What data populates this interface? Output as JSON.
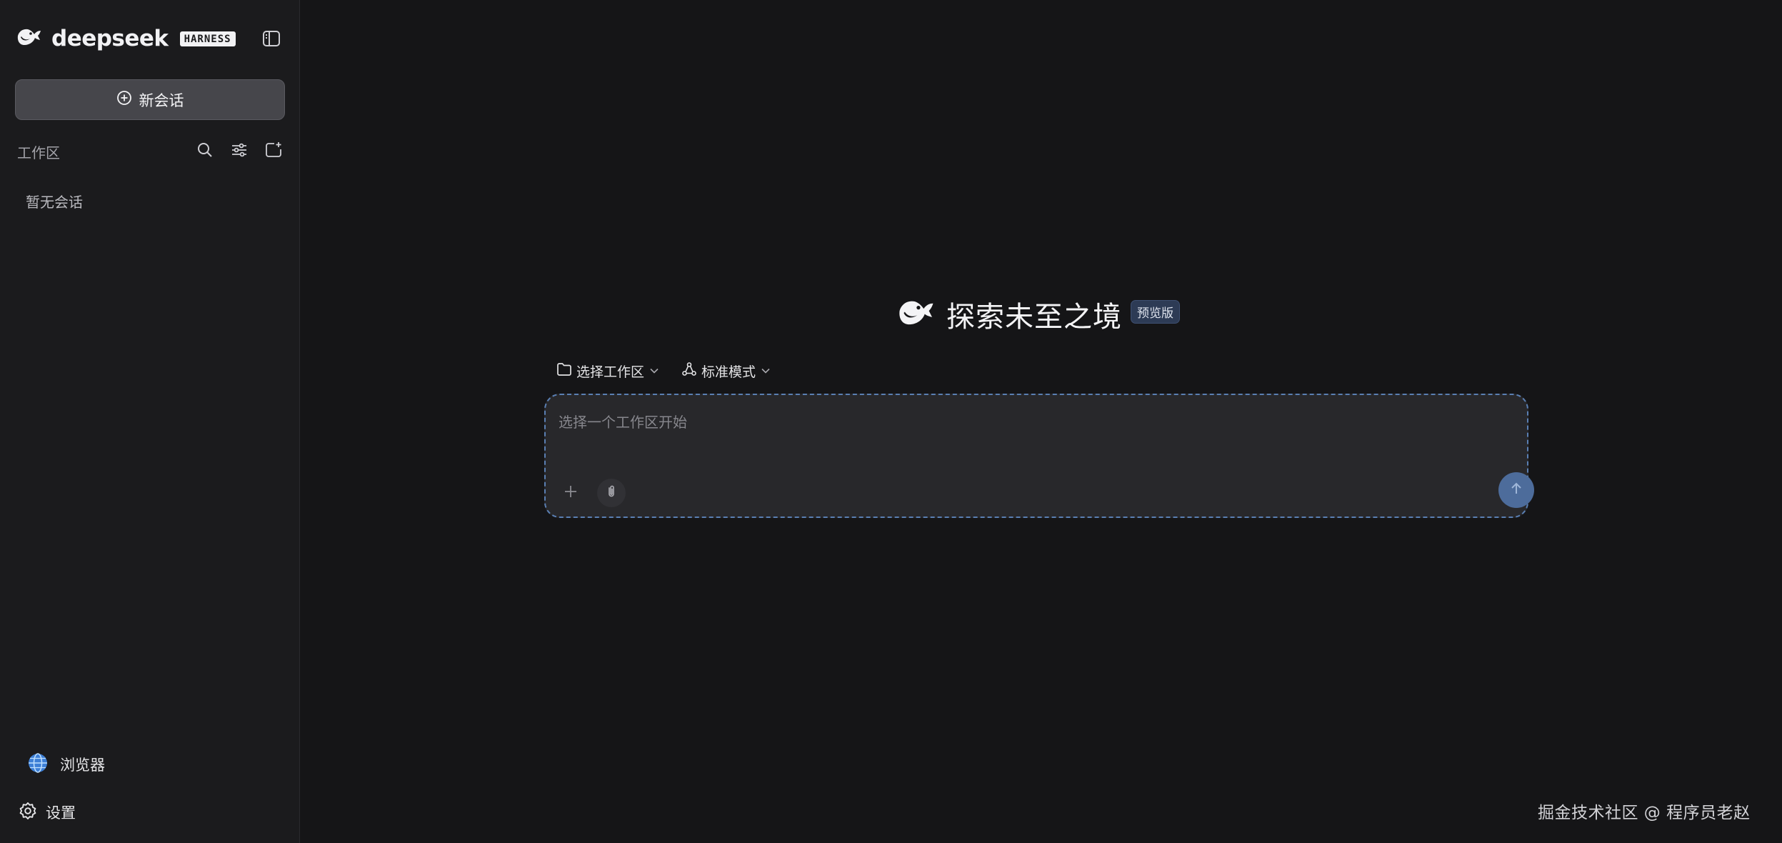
{
  "sidebar": {
    "brand": {
      "name": "deepseek",
      "tag": "HARNESS",
      "logo_icon": "whale-icon"
    },
    "toggle_icon": "sidebar-toggle-icon",
    "new_chat": {
      "label": "新会话",
      "icon": "plus-circle-icon"
    },
    "workspace": {
      "title": "工作区",
      "actions": [
        "search-icon",
        "filter-icon",
        "new-folder-icon"
      ]
    },
    "empty_text": "暂无会话",
    "footer": {
      "browser_label": "浏览器",
      "browser_icon": "globe-icon",
      "settings_label": "设置",
      "settings_icon": "gear-icon"
    }
  },
  "main": {
    "hero": {
      "title": "探索未至之境",
      "badge": "预览版",
      "logo_icon": "whale-icon"
    },
    "controls": {
      "workspace_select": {
        "label": "选择工作区",
        "icon": "folder-icon"
      },
      "mode_select": {
        "label": "标准模式",
        "icon": "mode-icon"
      }
    },
    "composer": {
      "placeholder": "选择一个工作区开始",
      "value": "",
      "add_icon": "plus-icon",
      "attach_icon": "paperclip-icon",
      "send_icon": "arrow-up-icon"
    }
  },
  "watermark": "掘金技术社区 @ 程序员老赵",
  "colors": {
    "background": "#151517",
    "sidebar": "#1b1b1d",
    "new_chat_button": "#46464b",
    "composer": "#28282b",
    "composer_border": "#5a7fb3",
    "send_button": "#4d6c9b",
    "badge": "#2d3b55"
  }
}
